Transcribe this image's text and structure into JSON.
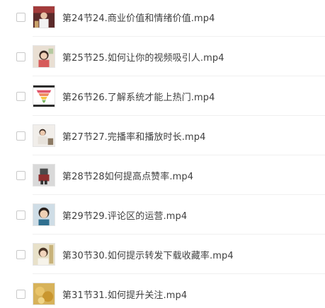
{
  "files": [
    {
      "name": "第24节24.商业价值和情绪价值.mp4",
      "thumb_icon": "video-thumbnail-icon",
      "checked": false
    },
    {
      "name": "第25节25.如何让你的视频吸引人.mp4",
      "thumb_icon": "video-thumbnail-icon",
      "checked": false
    },
    {
      "name": "第26节26.了解系统才能上热门.mp4",
      "thumb_icon": "video-thumbnail-icon",
      "checked": false
    },
    {
      "name": "第27节27.完播率和播放时长.mp4",
      "thumb_icon": "video-thumbnail-icon",
      "checked": false
    },
    {
      "name": "第28节28如何提高点赞率.mp4",
      "thumb_icon": "video-thumbnail-icon",
      "checked": false
    },
    {
      "name": "第29节29.评论区的运营.mp4",
      "thumb_icon": "video-thumbnail-icon",
      "checked": false
    },
    {
      "name": "第30节30.如何提示转发下载收藏率.mp4",
      "thumb_icon": "video-thumbnail-icon",
      "checked": false
    },
    {
      "name": "第31节31.如何提升关注.mp4",
      "thumb_icon": "video-thumbnail-icon",
      "checked": false
    }
  ]
}
